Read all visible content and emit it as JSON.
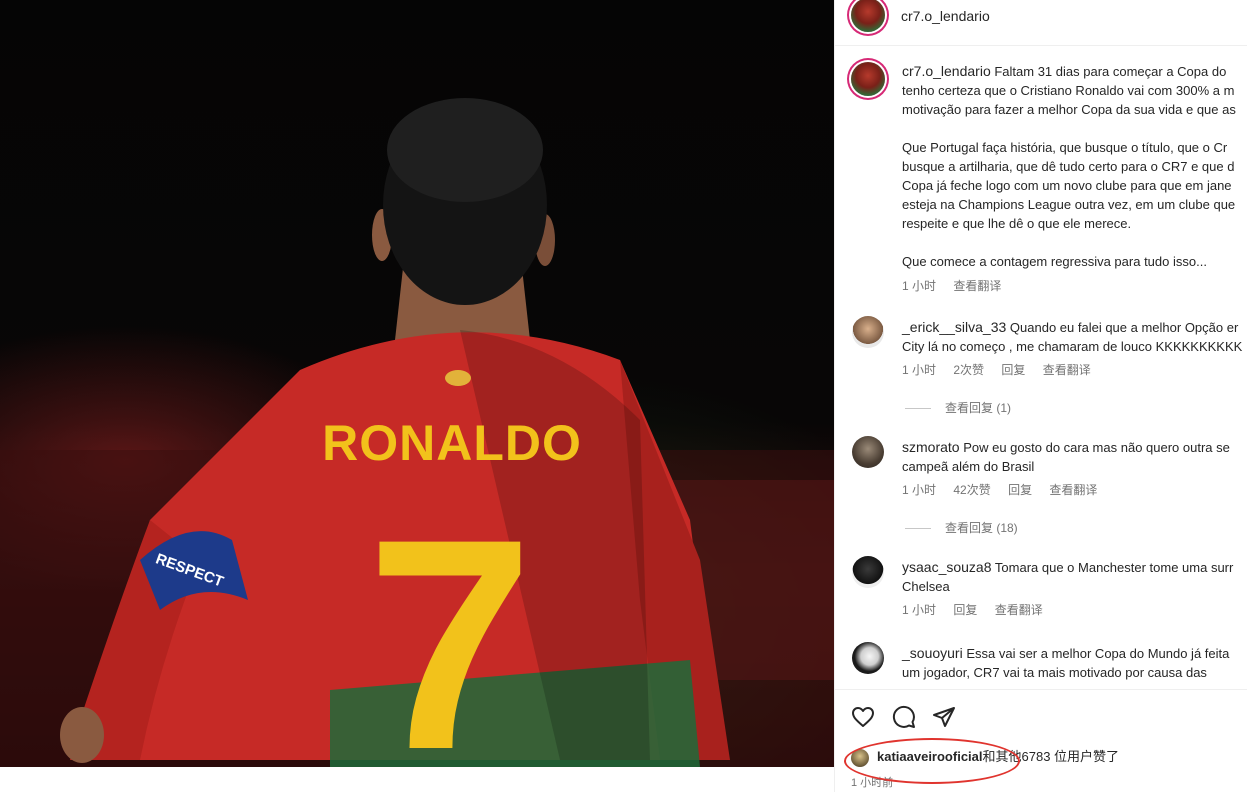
{
  "post": {
    "jersey_name": "RONALDO",
    "jersey_number": "7",
    "armband_text": "RESPECT"
  },
  "header": {
    "username": "cr7.o_lendario"
  },
  "caption": {
    "username": "cr7.o_lendario",
    "lines": [
      "Faltam 31 dias para começar a Copa do",
      "tenho certeza que o Cristiano Ronaldo vai com 300% a m",
      "motivação para fazer a melhor Copa da sua vida e que as",
      "",
      "Que Portugal faça história, que busque o título, que o Cr",
      "busque a artilharia, que dê tudo certo para o CR7 e que d",
      "Copa já feche logo com um novo clube para que em jane",
      "esteja na Champions League outra vez, em um clube que",
      "respeite e que lhe dê o que ele merece.",
      "",
      "Que comece a contagem regressiva para tudo isso..."
    ],
    "time": "1 小时",
    "translate": "查看翻译"
  },
  "comments": [
    {
      "username": "_erick__silva_33",
      "line1": "Quando eu falei que a melhor Opção er",
      "line2": "City lá no começo , me chamaram de louco KKKKKKKKKK",
      "time": "1 小时",
      "likes": "2次赞",
      "reply": "回复",
      "translate": "查看翻译",
      "view_replies": "查看回复 (1)"
    },
    {
      "username": "szmorato",
      "line1": "Pow eu gosto do cara mas não quero outra se",
      "line2": "campeã além do Brasil",
      "time": "1 小时",
      "likes": "42次赞",
      "reply": "回复",
      "translate": "查看翻译",
      "view_replies": "查看回复 (18)"
    },
    {
      "username": "ysaac_souza8",
      "line1": "Tomara que o Manchester tome uma surr",
      "line2": "Chelsea",
      "time": "1 小时",
      "reply": "回复",
      "translate": "查看翻译"
    },
    {
      "username": "_souoyuri",
      "line1": "Essa vai ser a melhor Copa do Mundo já feita",
      "line2": "um jogador, CR7 vai ta mais motivado por causa das"
    }
  ],
  "actions": {
    "icons": [
      "heart-icon",
      "comment-icon",
      "share-icon"
    ]
  },
  "likes": {
    "liker": "katiaaveirooficial",
    "rest": "和其他6783 位用户赞了"
  },
  "time_ago": "1 小时前",
  "colors": {
    "highlight_ring": "#e0342e",
    "jersey_red": "#c62a26",
    "jersey_number": "#f2c21b",
    "armband": "#1d3a8a"
  }
}
